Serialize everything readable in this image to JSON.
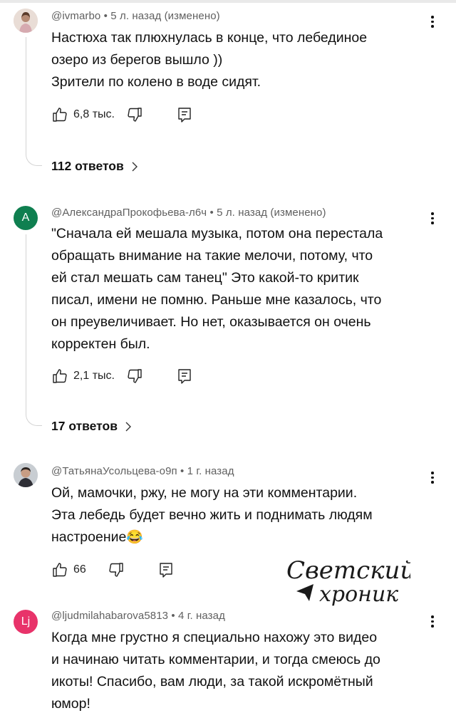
{
  "comments": [
    {
      "author": "@ivmarbo",
      "time": "5 л. назад (изменено)",
      "text": "Настюха так плюхнулась в конце, что лебединое\nозеро из берегов вышло ))\nЗрители по колено в воде сидят.",
      "likes": "6,8 тыс.",
      "replies": "112 ответов",
      "avatar": "photo"
    },
    {
      "author": "@АлександраПрокофьева-л6ч",
      "time": "5 л. назад (изменено)",
      "text": "\"Сначала ей мешала музыка, потом она перестала\nобращать внимание на такие мелочи, потому, что\nей стал мешать сам танец\" Это какой-то критик\nписал, имени не помню. Раньше мне казалось, что\nон преувеличивает. Но нет, оказывается он очень\nкорректен был.",
      "likes": "2,1 тыс.",
      "replies": "17 ответов",
      "avatar": "A",
      "avatar_color": "#0f7f50"
    },
    {
      "author": "@ТатьянаУсольцева-о9п",
      "time": "1 г. назад",
      "text": "Ой, мамочки, ржу, не могу на эти комментарии.\nЭта лебедь будет вечно жить и поднимать людям\nнастроение",
      "emoji": "😂",
      "likes": "66",
      "avatar": "photo"
    },
    {
      "author": "@ljudmilahabarova5813",
      "time": "4 г. назад",
      "text": "Когда мне грустно я специально нахожу это видео\nи начинаю читать комментарии, и тогда смеюсь до\nикоты! Спасибо, вам люди, за такой искромётный\nюмор!",
      "avatar": "Lj",
      "avatar_color": "#e8336a"
    }
  ],
  "icons": {
    "like": "thumbs-up-icon",
    "dislike": "thumbs-down-icon",
    "reply": "comment-icon",
    "more": "more-vert-icon",
    "chevron": "chevron-right-icon"
  },
  "watermark": {
    "line1": "Светский",
    "line2": "хроник"
  }
}
